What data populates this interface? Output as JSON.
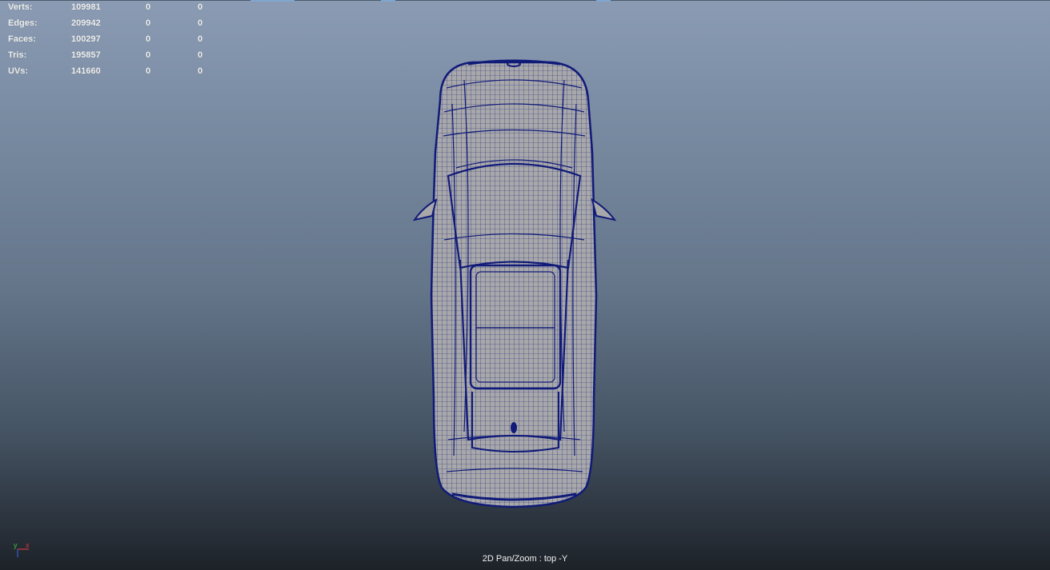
{
  "viewport": {
    "camera_label": "2D Pan/Zoom : top -Y"
  },
  "hud": {
    "rows": [
      {
        "label": "Verts:",
        "total": "109981",
        "selected": "0",
        "triangles": "0"
      },
      {
        "label": "Edges:",
        "total": "209942",
        "selected": "0",
        "triangles": "0"
      },
      {
        "label": "Faces:",
        "total": "100297",
        "selected": "0",
        "triangles": "0"
      },
      {
        "label": "Tris:",
        "total": "195857",
        "selected": "0",
        "triangles": "0"
      },
      {
        "label": "UVs:",
        "total": "141660",
        "selected": "0",
        "triangles": "0"
      }
    ]
  },
  "axis_gizmo": {
    "x_label": "x",
    "y_label": "y",
    "x_color": "#d23a3a",
    "y_color": "#3fbf3f",
    "z_color": "#3a5ad8"
  },
  "colors": {
    "wireframe": "#101a78",
    "mesh_fill": "#a8a8aa",
    "hud_text": "#f0f0f0"
  }
}
